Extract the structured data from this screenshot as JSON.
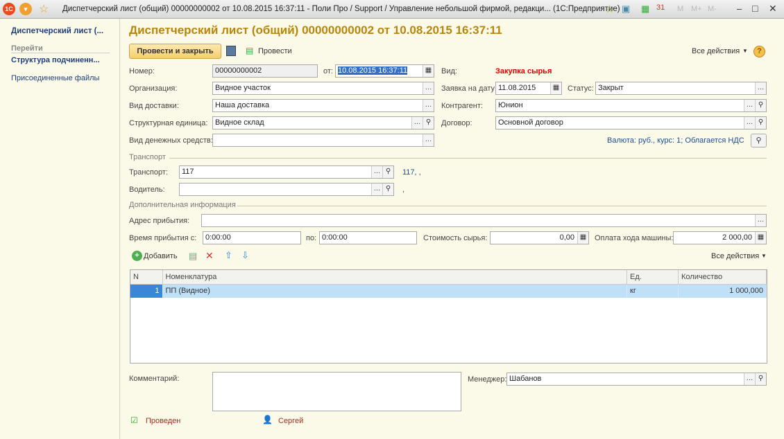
{
  "window": {
    "title": "Диспетчерский лист (общий) 00000000002 от 10.08.2015 16:37:11 - Поли Про / Support / Управление небольшой фирмой, редакци... (1С:Предприятие)",
    "memory_buttons": [
      "M",
      "M+",
      "M-"
    ]
  },
  "sidebar": {
    "current": "Диспетчерский лист (...",
    "goto_header": "Перейти",
    "items": [
      {
        "label": "Структура подчиненн..."
      },
      {
        "label": "Присоединенные файлы"
      }
    ]
  },
  "form": {
    "title": "Диспетчерский лист (общий) 00000000002 от 10.08.2015 16:37:11",
    "toolbar": {
      "post_close": "Провести и закрыть",
      "post": "Провести",
      "all_actions": "Все действия",
      "help": "?"
    },
    "number_label": "Номер:",
    "number": "00000000002",
    "date_label": "от:",
    "date": "10.08.2015 16:37:11",
    "kind_label": "Вид:",
    "kind": "Закупка сырья",
    "org_label": "Организация:",
    "org": "Видное участок",
    "req_date_label": "Заявка на дату:",
    "req_date": "11.08.2015",
    "status_label": "Статус:",
    "status": "Закрыт",
    "delivery_label": "Вид доставки:",
    "delivery": "Наша доставка",
    "counterparty_label": "Контрагент:",
    "counterparty": "Юнион",
    "unit_label": "Структурная единица:",
    "unit": "Видное склад",
    "contract_label": "Договор:",
    "contract": "Основной договор",
    "cash_label": "Вид денежных средств:",
    "cash": "",
    "currency_info": "Валюта: руб., курс: 1; Облагается НДС",
    "transport_section": "Транспорт",
    "transport_label": "Транспорт:",
    "transport": "117",
    "transport_info": "117, ,",
    "driver_label": "Водитель:",
    "driver": "",
    "driver_info": ",",
    "extra_section": "Дополнительная информация",
    "address_label": "Адрес прибытия:",
    "address": "",
    "time_from_label": "Время прибытия с:",
    "time_from": "0:00:00",
    "time_to_label": "по:",
    "time_to": "0:00:00",
    "raw_cost_label": "Стоимость сырья:",
    "raw_cost": "0,00",
    "run_pay_label": "Оплата хода машины:",
    "run_pay": "2 000,00",
    "table_toolbar": {
      "add": "Добавить",
      "all_actions": "Все действия"
    },
    "table": {
      "columns": [
        "N",
        "Номенклатура",
        "Ед.",
        "Количество"
      ],
      "rows": [
        {
          "n": "1",
          "item": "ПП (Видное)",
          "unit": "кг",
          "qty": "1 000,000"
        }
      ]
    },
    "comment_label": "Комментарий:",
    "comment": "",
    "manager_label": "Менеджер:",
    "manager": "Шабанов",
    "footer": {
      "status": "Проведен",
      "author": "Сергей"
    }
  },
  "colors": {
    "title": "#b8860b",
    "kind": "#e00000",
    "link": "#1f4e8c",
    "selection": "#bfe0f7"
  }
}
